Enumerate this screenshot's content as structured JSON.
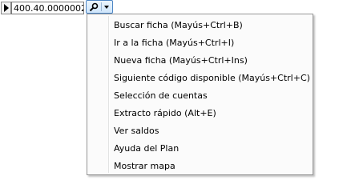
{
  "field": {
    "value": "400.40.0000002"
  },
  "icons": {
    "row_marker": "row-selector-arrow-icon",
    "search": "magnifier-icon",
    "dropdown": "chevron-down-icon"
  },
  "menu": {
    "items": [
      {
        "label": "Buscar ficha (Mayús+Ctrl+B)"
      },
      {
        "label": "Ir a la ficha (Mayús+Ctrl+I)"
      },
      {
        "label": "Nueva ficha (Mayús+Ctrl+Ins)"
      },
      {
        "label": "Siguiente código disponible (Mayús+Ctrl+C)"
      },
      {
        "label": "Selección de cuentas"
      },
      {
        "label": "Extracto rápido (Alt+E)"
      },
      {
        "label": "Ver saldos"
      },
      {
        "label": "Ayuda del Plan"
      },
      {
        "label": "Mostrar mapa"
      }
    ]
  }
}
